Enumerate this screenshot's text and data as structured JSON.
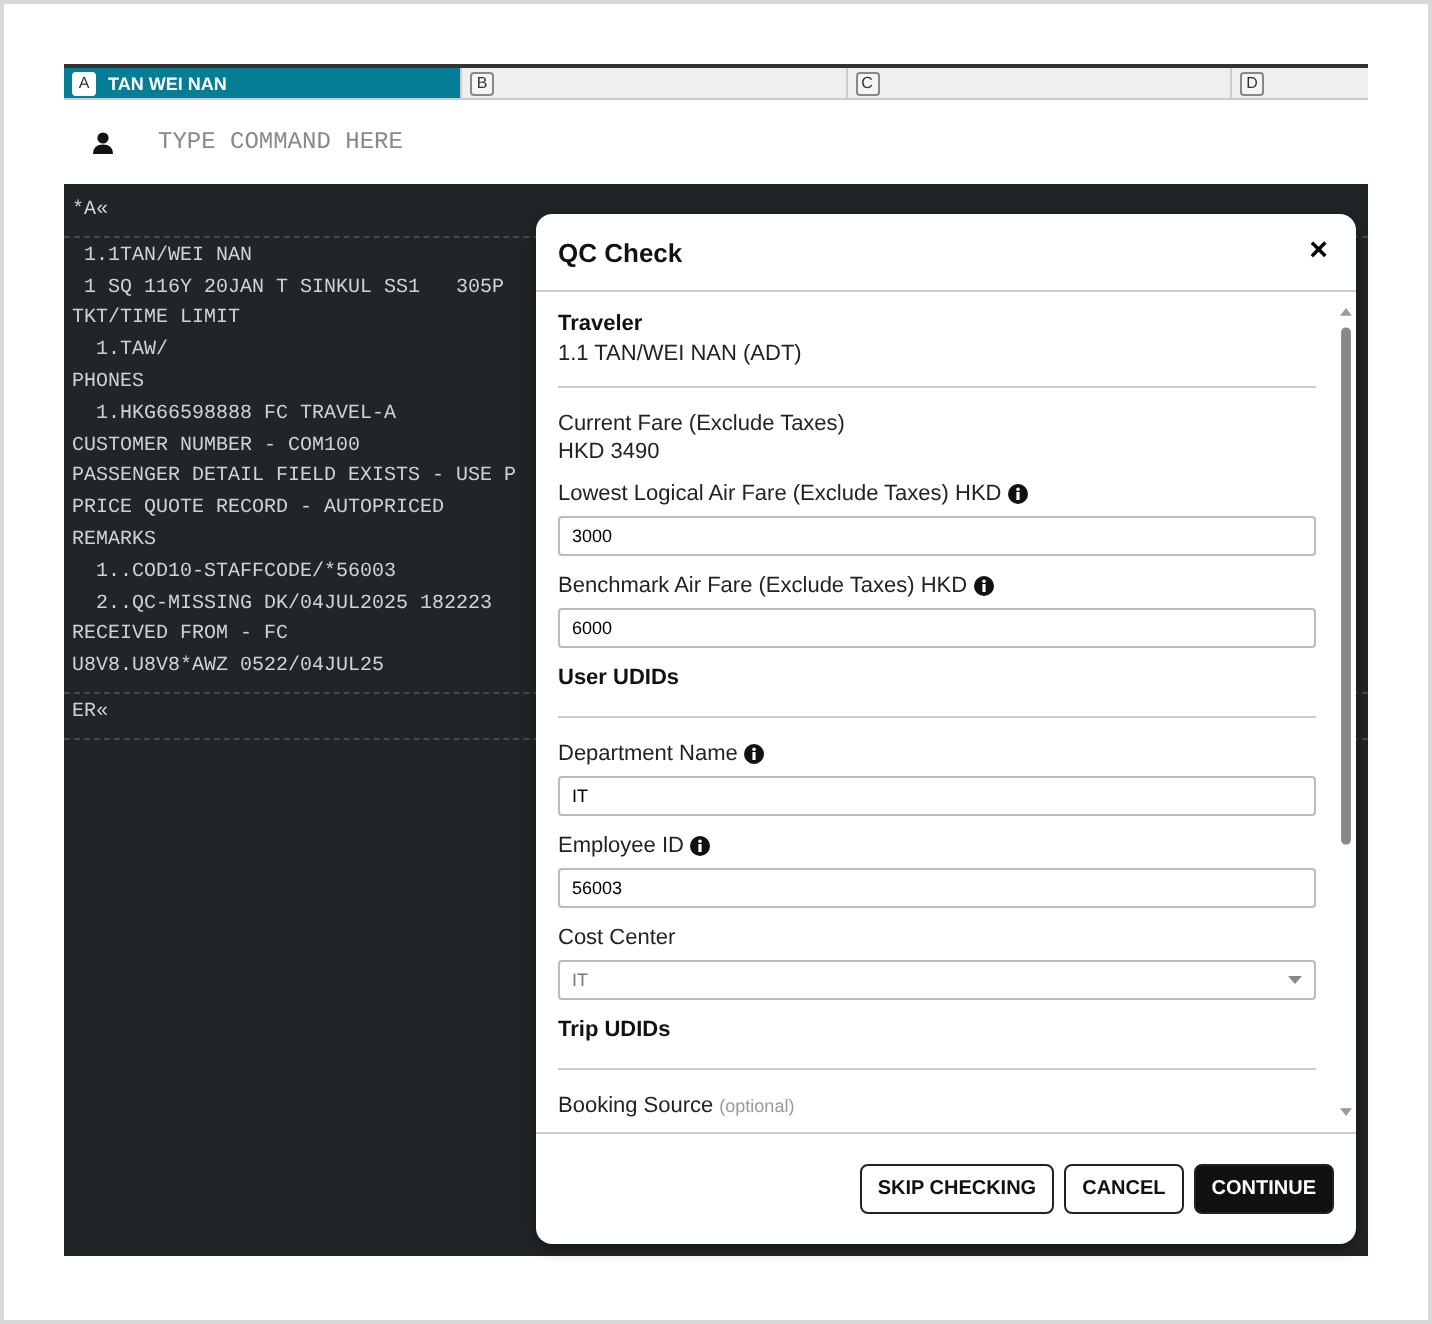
{
  "tabs": [
    {
      "letter": "A",
      "label": "TAN WEI NAN",
      "selected": true
    },
    {
      "letter": "B",
      "selected": false
    },
    {
      "letter": "C",
      "selected": false
    },
    {
      "letter": "D",
      "selected": false
    }
  ],
  "command": {
    "placeholder": "TYPE COMMAND HERE"
  },
  "terminal": {
    "blocks": [
      {
        "lines": [
          "*A«"
        ]
      },
      {
        "lines": [
          " 1.1TAN/WEI NAN",
          " 1 SQ 116Y 20JAN T SINKUL SS1   305P",
          "TKT/TIME LIMIT",
          "  1.TAW/",
          "PHONES",
          "  1.HKG66598888 FC TRAVEL-A",
          "CUSTOMER NUMBER - COM100",
          "PASSENGER DETAIL FIELD EXISTS - USE P",
          "PRICE QUOTE RECORD - AUTOPRICED",
          "REMARKS",
          "  1..COD10-STAFFCODE/*56003",
          "  2..QC-MISSING DK/04JUL2025 182223",
          "RECEIVED FROM - FC",
          "U8V8.U8V8*AWZ 0522/04JUL25"
        ]
      },
      {
        "lines": [
          "ER«"
        ]
      }
    ]
  },
  "dialog": {
    "title": "QC Check",
    "close": "×",
    "items": [
      {
        "kind": "heading",
        "label": "Traveler",
        "value": "1.1 TAN/WEI NAN (ADT)"
      },
      {
        "kind": "readonly",
        "label": "Current Fare (Exclude Taxes)",
        "value": "HKD 3490"
      },
      {
        "kind": "input",
        "label": "Lowest Logical Air Fare (Exclude Taxes) HKD",
        "info": true,
        "value": "3000"
      },
      {
        "kind": "input",
        "label": "Benchmark Air Fare (Exclude Taxes) HKD",
        "info": true,
        "value": "6000"
      },
      {
        "kind": "heading",
        "label": "User UDIDs"
      },
      {
        "kind": "input",
        "label": "Department Name",
        "info": true,
        "value": "IT"
      },
      {
        "kind": "input",
        "label": "Employee ID",
        "info": true,
        "value": "56003"
      },
      {
        "kind": "select",
        "label": "Cost Center",
        "info": false,
        "value": "IT"
      },
      {
        "kind": "heading",
        "label": "Trip UDIDs"
      },
      {
        "kind": "label",
        "label": "Booking Source",
        "hint": "(optional)"
      }
    ],
    "buttons": [
      {
        "label": "SKIP CHECKING",
        "primary": false
      },
      {
        "label": "CANCEL",
        "primary": false
      },
      {
        "label": "CONTINUE",
        "primary": true
      }
    ]
  }
}
